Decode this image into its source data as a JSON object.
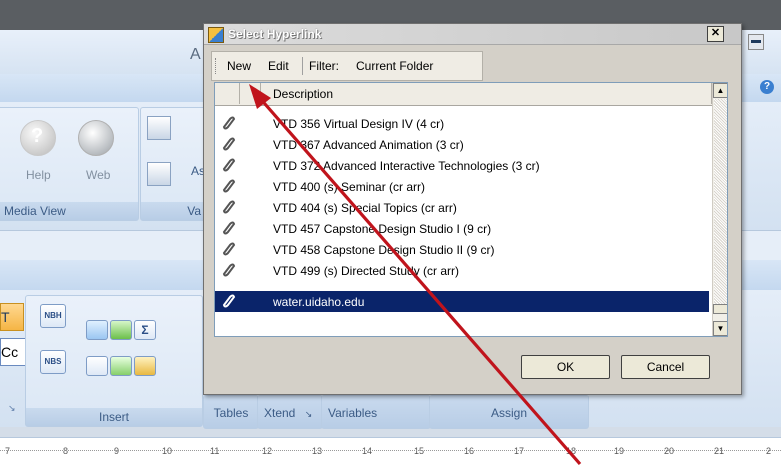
{
  "background_app": {
    "title_fragment": "A",
    "ribbon": {
      "media_group": {
        "buttons": [
          "Help",
          "Web"
        ],
        "label": "Media View"
      },
      "va_group_label": "Va",
      "as_fragment": "As"
    },
    "lower_ribbon": {
      "left_fragments": [
        "T",
        "Cc"
      ],
      "small_buttons": [
        "NBH",
        "NBS"
      ],
      "sigma": "Σ",
      "group_labels": {
        "insert": "Insert",
        "tables": "Tables",
        "xtend": "Xtend",
        "variables": "Variables",
        "assign": "Assign"
      }
    },
    "ruler_numbers": [
      "7",
      "8",
      "9",
      "10",
      "11",
      "12",
      "13",
      "14",
      "15",
      "16",
      "17",
      "18",
      "19",
      "20",
      "21",
      "2"
    ]
  },
  "dialog": {
    "title": "Select Hyperlink",
    "close_glyph": "✕",
    "toolbar": {
      "new": "New",
      "edit": "Edit",
      "filter": "Filter:",
      "filter_value": "Current Folder"
    },
    "list": {
      "header_description": "Description",
      "rows": [
        {
          "text": "VTD 356 Virtual Design IV (4 cr)",
          "selected": false
        },
        {
          "text": "VTD 367  Advanced Animation (3 cr)",
          "selected": false
        },
        {
          "text": "VTD 372  Advanced Interactive Technologies (3 cr)",
          "selected": false
        },
        {
          "text": "VTD 400  (s) Seminar (cr arr)",
          "selected": false
        },
        {
          "text": "VTD 404  (s) Special Topics (cr arr)",
          "selected": false
        },
        {
          "text": "VTD 457 Capstone Design Studio I (9 cr)",
          "selected": false
        },
        {
          "text": "VTD 458 Capstone Design Studio II (9 cr)",
          "selected": false
        },
        {
          "text": "VTD 499  (s) Directed Study (cr arr)",
          "selected": false
        },
        {
          "text": "water.uidaho.edu",
          "selected": true
        }
      ]
    },
    "buttons": {
      "ok": "OK",
      "cancel": "Cancel"
    }
  },
  "annotation": {
    "arrow_color": "#c0141c"
  },
  "colors": {
    "selection": "#0a246a",
    "dialog_face": "#d4d0c8"
  }
}
